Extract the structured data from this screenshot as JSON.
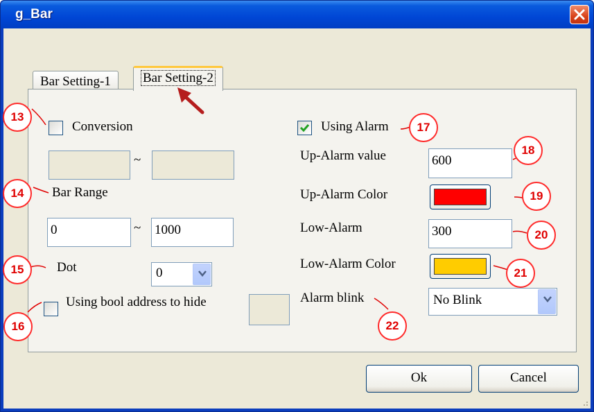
{
  "window": {
    "title": "g_Bar"
  },
  "tabs": [
    {
      "label": "Bar Setting-1"
    },
    {
      "label": "Bar Setting-2"
    }
  ],
  "left": {
    "conversion": {
      "label": "Conversion",
      "checked": false,
      "from_value": "",
      "to_value": ""
    },
    "bar_range": {
      "label": "Bar Range",
      "min": "0",
      "max": "1000",
      "separator": "~"
    },
    "dot": {
      "label": "Dot",
      "value": "0"
    },
    "hide": {
      "label": "Using bool address to hide",
      "checked": false,
      "address": ""
    }
  },
  "right": {
    "using_alarm": {
      "label": "Using Alarm",
      "checked": true
    },
    "up_alarm_value": {
      "label": "Up-Alarm value",
      "value": "600"
    },
    "up_alarm_color": {
      "label": "Up-Alarm Color",
      "color": "#ff0000"
    },
    "low_alarm": {
      "label": "Low-Alarm",
      "value": "300"
    },
    "low_alarm_color": {
      "label": "Low-Alarm Color",
      "color": "#ffcc00"
    },
    "alarm_blink": {
      "label": "Alarm blink",
      "value": "No Blink"
    }
  },
  "buttons": {
    "ok": "Ok",
    "cancel": "Cancel"
  },
  "annotations": [
    "13",
    "14",
    "15",
    "16",
    "17",
    "18",
    "19",
    "20",
    "21",
    "22"
  ],
  "colors": {
    "title_bar": "#0046d5",
    "annotation": "#e00000",
    "dialog_bg": "#ece9d8"
  }
}
